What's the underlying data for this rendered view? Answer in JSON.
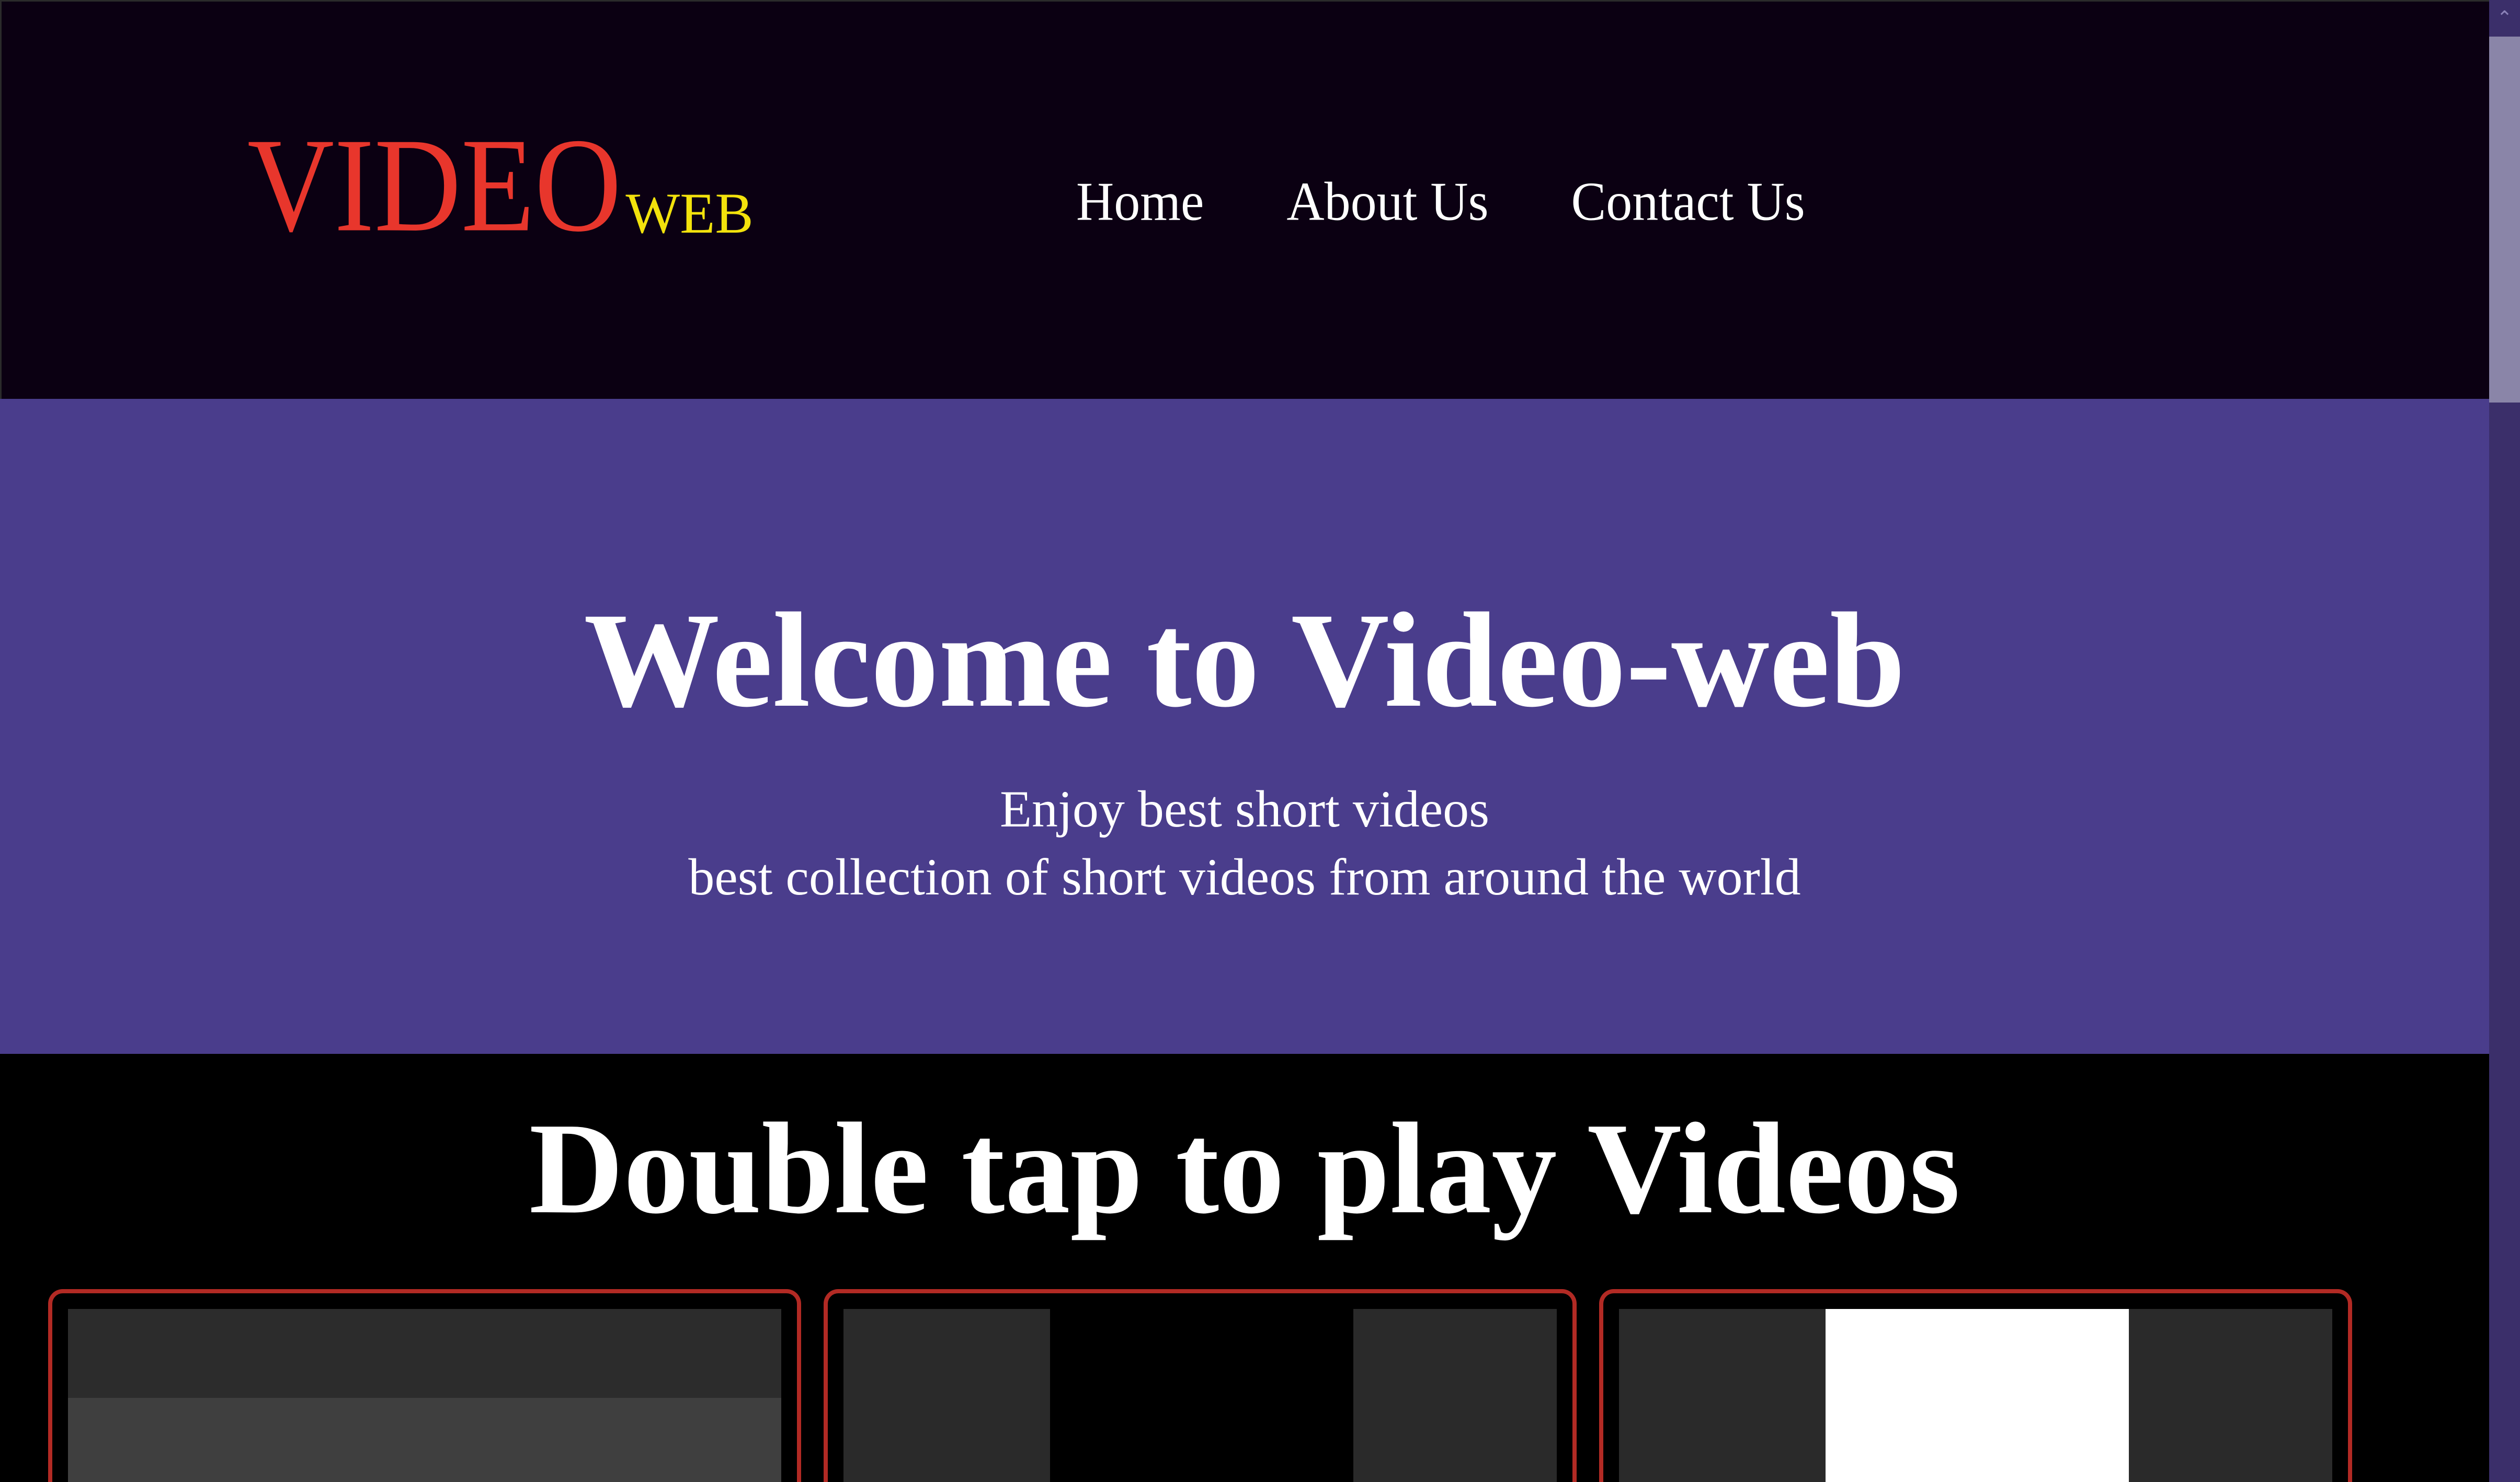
{
  "header": {
    "logo_main": "VIDEO",
    "logo_sub": "WEB",
    "nav": [
      "Home",
      "About Us",
      "Contact Us"
    ]
  },
  "hero": {
    "title": "Welcome to Video-web",
    "subtitle_line1": "Enjoy best short videos",
    "subtitle_line2": "best collection of short videos from around the world"
  },
  "videos": {
    "title": "Double tap to play Videos"
  },
  "colors": {
    "header_bg": "#0b0012",
    "hero_bg": "#4a3d8c",
    "logo_main": "#e8362c",
    "logo_sub": "#f2e20c",
    "card_border": "#b22a24"
  },
  "scrollbar": {
    "up_icon": "chevron-up-icon"
  }
}
